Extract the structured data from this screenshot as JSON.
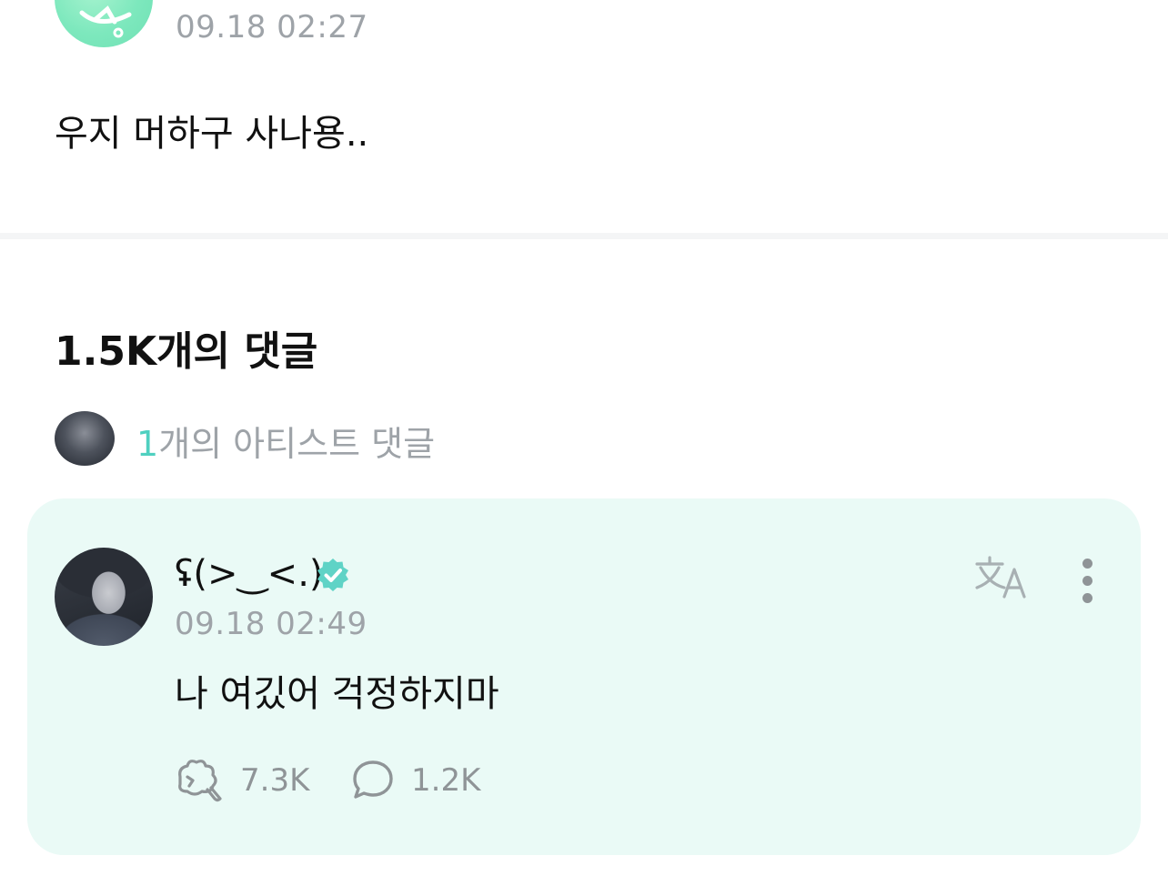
{
  "post": {
    "time": "09.18 02:27",
    "body": "우지 머하구 사나용.."
  },
  "comments": {
    "count_title": "1.5K개의 댓글",
    "artist_row": {
      "count": "1",
      "label": "개의 아티스트 댓글"
    }
  },
  "artist_comment": {
    "author": "ʢ(>‿<.)",
    "verified": true,
    "time": "09.18 02:49",
    "body": "나 여깄어 걱정하지마",
    "likes": "7.3K",
    "replies": "1.2K"
  },
  "colors": {
    "accent": "#4fd0c0",
    "card_background": "#eafaf6",
    "muted_text": "#9ea3a8",
    "post_avatar": "#7de8bd"
  },
  "icons": {
    "post_avatar": "mint-logo-avatar",
    "verified": "verified-badge-icon",
    "translate": "translate-icon",
    "more": "more-vertical-icon",
    "like": "like-pawprint-icon",
    "reply": "speech-bubble-icon"
  }
}
